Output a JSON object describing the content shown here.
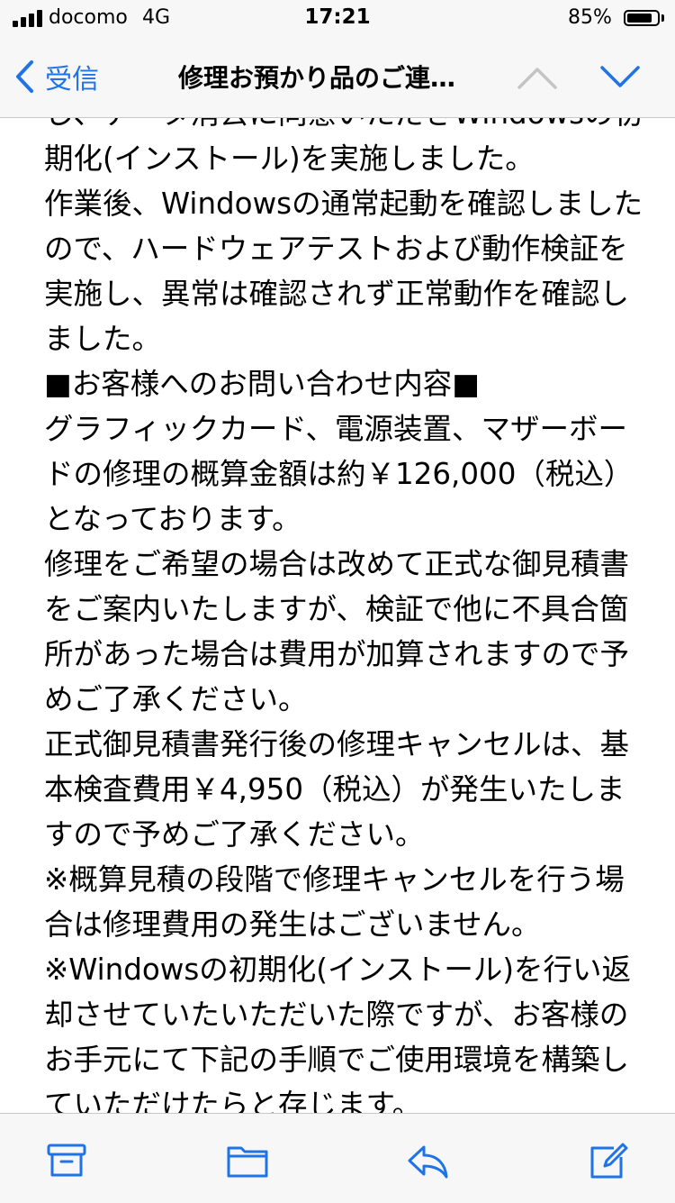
{
  "status_bar": {
    "carrier": "docomo",
    "network": "4G",
    "time": "17:21",
    "battery_percent": "85%",
    "battery_level": 0.85
  },
  "nav": {
    "back_label": "受信",
    "title": "修理お預かり品のご連…",
    "icons": {
      "back": "chevron-left-icon",
      "previous": "chevron-up-icon",
      "next": "chevron-down-icon"
    }
  },
  "message": {
    "lines": [
      "し、データ消去に同意いただきWindowsの初",
      "期化(インストール)を実施しました。",
      "作業後、Windowsの通常起動を確認しました",
      "ので、ハードウェアテストおよび動作検証を",
      "実施し、異常は確認されず正常動作を確認し",
      "ました。",
      "■お客様へのお問い合わせ内容■",
      "グラフィックカード、電源装置、マザーボー",
      "ドの修理の概算金額は約￥126,000（税込）",
      "となっております。",
      "修理をご希望の場合は改めて正式な御見積書",
      "をご案内いたしますが、検証で他に不具合箇",
      "所があった場合は費用が加算されますので予",
      "めご了承ください。",
      "正式御見積書発行後の修理キャンセルは、基",
      "本検査費用￥4,950（税込）が発生いたしま",
      "すので予めご了承ください。",
      "※概算見積の段階で修理キャンセルを行う場",
      "合は修理費用の発生はございません。",
      "※Windowsの初期化(インストール)を行い返",
      "却させていたいただいた際ですが、お客様の",
      "お手元にて下記の手順でご使用環境を構築し",
      "ていただけたらと存じます。"
    ]
  },
  "toolbar": {
    "items": [
      "archive-icon",
      "folder-icon",
      "reply-icon",
      "compose-icon"
    ]
  },
  "colors": {
    "accent": "#1f73e6",
    "bar_background": "#f7f7f7",
    "separator": "#c8c8c8",
    "disabled": "#c4c4c4"
  }
}
